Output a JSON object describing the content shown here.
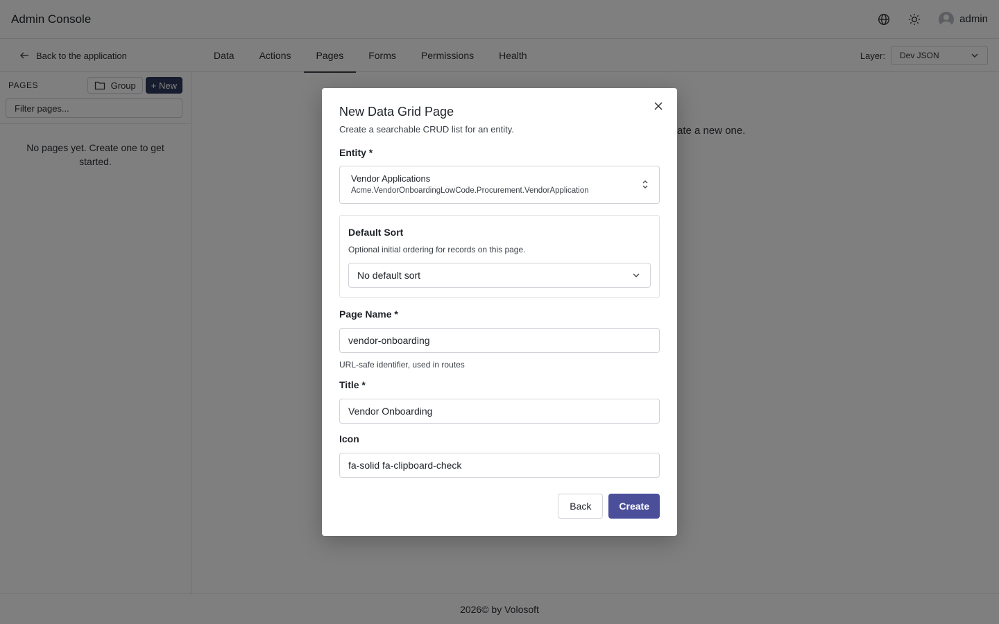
{
  "header": {
    "app_title": "Admin Console",
    "user_name": "admin",
    "icons": [
      "globe-icon",
      "sun-icon",
      "user-avatar-icon"
    ]
  },
  "nav": {
    "back_label": "Back to the application",
    "tabs": [
      {
        "label": "Data",
        "active": false
      },
      {
        "label": "Actions",
        "active": false
      },
      {
        "label": "Pages",
        "active": true
      },
      {
        "label": "Forms",
        "active": false
      },
      {
        "label": "Permissions",
        "active": false
      },
      {
        "label": "Health",
        "active": false
      }
    ],
    "layer_label": "Layer:",
    "layer_value": "Dev JSON"
  },
  "sidebar": {
    "title": "PAGES",
    "group_label": "Group",
    "new_label": "+ New",
    "filter_placeholder": "Filter pages...",
    "empty_message": "No pages yet. Create one to get started."
  },
  "main": {
    "hint_visible_fragment": "ate a new one."
  },
  "footer": {
    "text": "2026© by Volosoft"
  },
  "modal": {
    "title": "New Data Grid Page",
    "subtitle": "Create a searchable CRUD list for an entity.",
    "entity_label": "Entity *",
    "entity_name": "Vendor Applications",
    "entity_namespace": "Acme.VendorOnboardingLowCode.Procurement.VendorApplication",
    "default_sort_title": "Default Sort",
    "default_sort_desc": "Optional initial ordering for records on this page.",
    "default_sort_value": "No default sort",
    "page_name_label": "Page Name *",
    "page_name_value": "vendor-onboarding",
    "page_name_help": "URL-safe identifier, used in routes",
    "title_label": "Title *",
    "title_value": "Vendor Onboarding",
    "icon_label": "Icon",
    "icon_value": "fa-solid fa-clipboard-check",
    "back_button": "Back",
    "create_button": "Create"
  },
  "colors": {
    "overlay": "rgba(0,0,0,0.5)",
    "primary": "#4b4f9a",
    "new_button": "#2f3a5c"
  }
}
